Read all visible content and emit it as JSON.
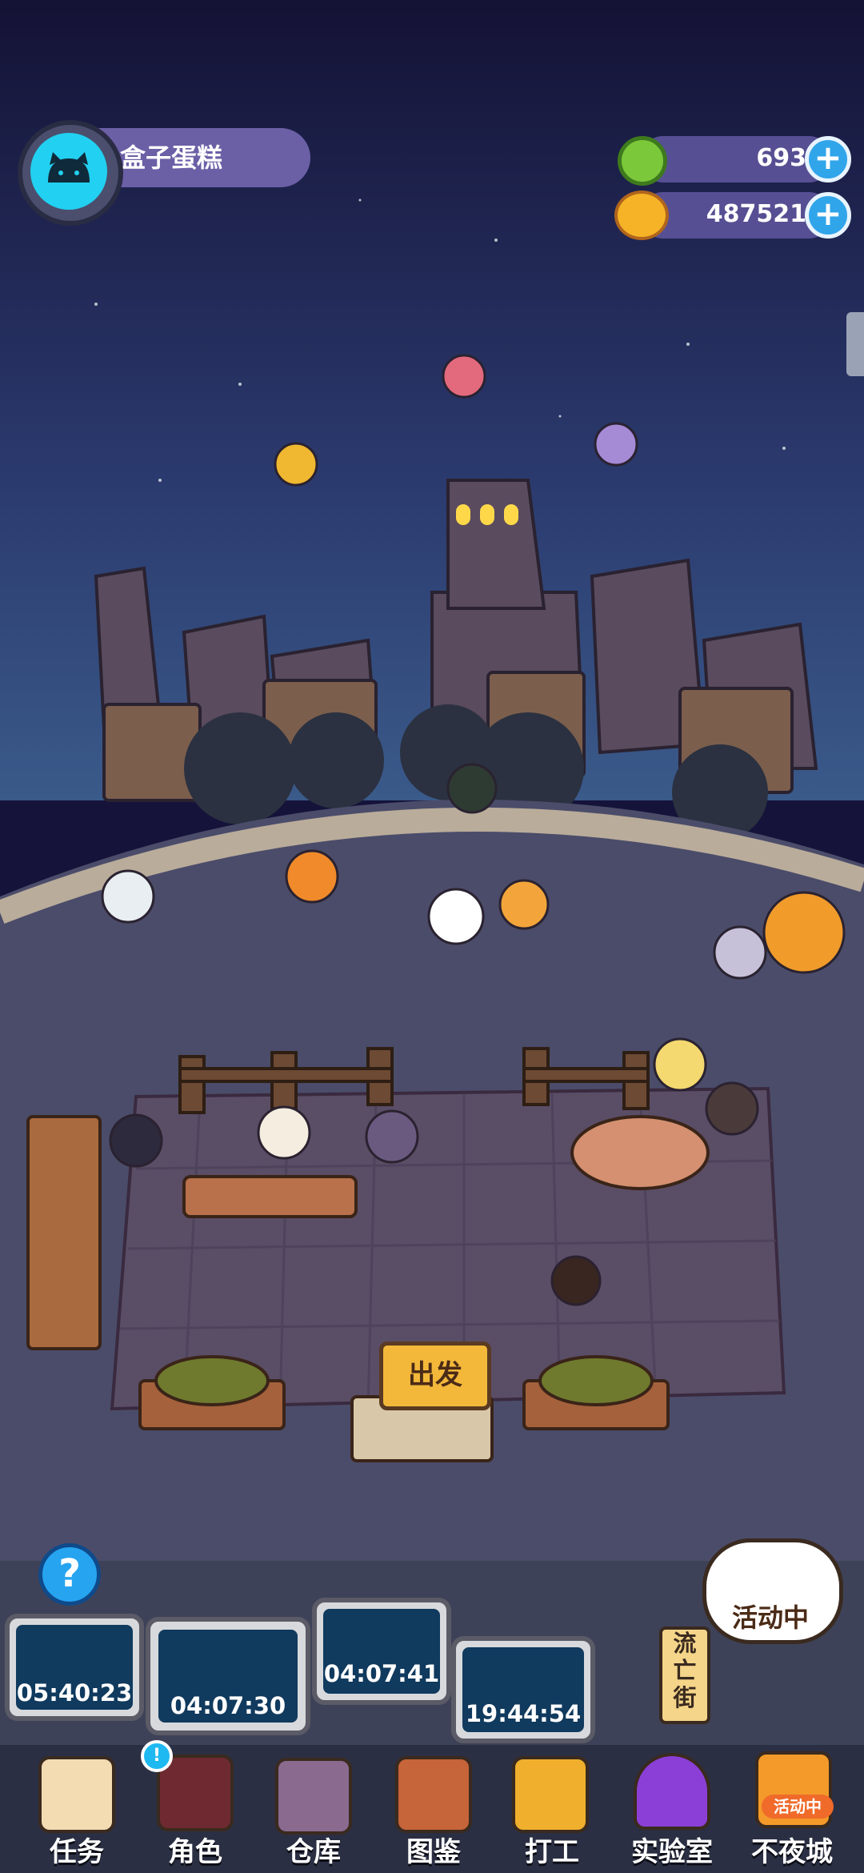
{
  "profile": {
    "name": "盒子蛋糕",
    "avatar_icon": "cat-avatar-icon"
  },
  "currency": [
    {
      "icon": "green-gem-icon",
      "value": "693"
    },
    {
      "icon": "gold-planet-coin-icon",
      "value": "487521"
    }
  ],
  "scene": {
    "go_sign": "出发"
  },
  "timers": [
    "05:40:23",
    "04:07:30",
    "04:07:41",
    "19:44:54"
  ],
  "side": {
    "exile_street": "流亡街",
    "event_tag": "活动中"
  },
  "nav": {
    "items": [
      {
        "label": "任务",
        "icon": "scroll-icon"
      },
      {
        "label": "角色",
        "icon": "character-portrait-icon"
      },
      {
        "label": "仓库",
        "icon": "chest-icon"
      },
      {
        "label": "图鉴",
        "icon": "book-icon"
      },
      {
        "label": "打工",
        "icon": "work-monitor-icon"
      },
      {
        "label": "实验室",
        "icon": "lab-dome-icon"
      },
      {
        "label": "不夜城",
        "icon": "fox-mascot-icon"
      }
    ],
    "active_badge": "活动中",
    "notification": "!"
  },
  "colors": {
    "night_sky": "#15133a",
    "plaza": "#4b4c6a",
    "accent_blue": "#31a5ea",
    "timer_screen": "#103a5e"
  }
}
